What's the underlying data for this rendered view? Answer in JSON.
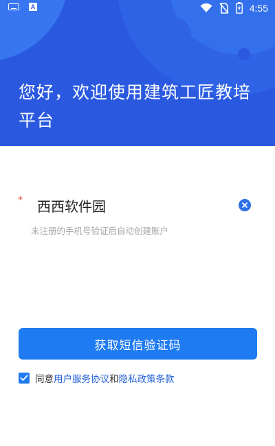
{
  "status_bar": {
    "time": "4:55",
    "icons": [
      "keyboard-icon",
      "a-app-icon",
      "wifi-icon",
      "no-sim-icon",
      "battery-charging-icon"
    ]
  },
  "header": {
    "welcome_line1": "您好，欢迎使用建筑工匠教培",
    "welcome_line2": "平台"
  },
  "form": {
    "required_mark": "*",
    "phone_value": "西西软件园",
    "hint": "未注册的手机号验证后自动创建账户",
    "clear_icon": "clear-circle-icon"
  },
  "sms_button": {
    "label": "获取短信验证码"
  },
  "agreement": {
    "checked": true,
    "prefix": "同意",
    "user_agreement": "用户服务协议",
    "and": "和",
    "privacy_policy": "隐私政策条款"
  },
  "colors": {
    "header_blue": "#2a59e0",
    "primary_button": "#1f7bf2",
    "link": "#1f5fd6",
    "required": "#e4534a",
    "hint_gray": "#a5a5a5"
  }
}
